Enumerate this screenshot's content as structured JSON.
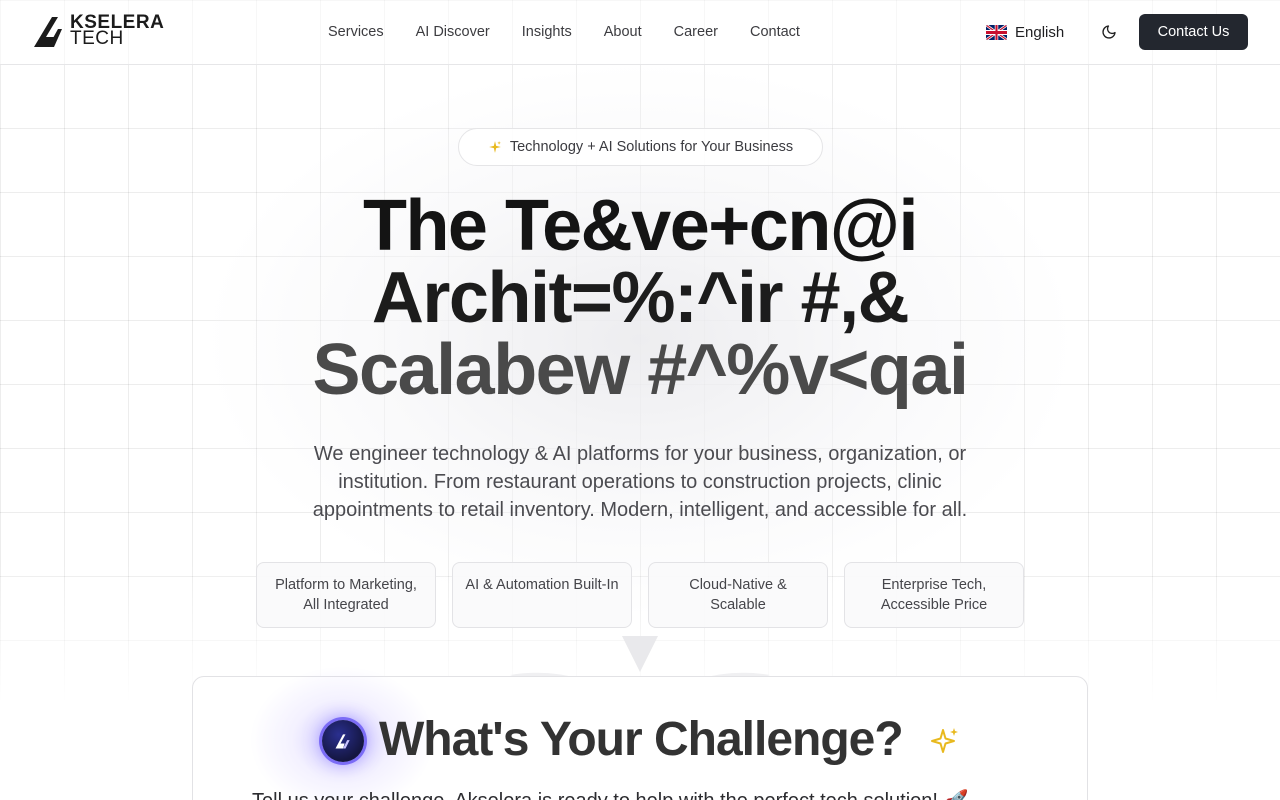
{
  "header": {
    "logo": {
      "line1": "KSELERA",
      "line2": "TECH"
    },
    "nav": [
      "Services",
      "AI Discover",
      "Insights",
      "About",
      "Career",
      "Contact"
    ],
    "language": {
      "label": "English",
      "icon": "uk-flag-icon"
    },
    "theme_icon": "moon-icon",
    "contact_label": "Contact Us"
  },
  "hero": {
    "badge": {
      "icon": "sparkle-icon",
      "text": "Technology + AI Solutions for Your Business"
    },
    "title_lines": [
      "The Te&ve+cn@i",
      "Archit=%:^ir #,&",
      "Scalabew #^%v<qai"
    ],
    "description": "We engineer technology & AI platforms for your business, organization, or institution. From restaurant operations to construction projects, clinic appointments to retail inventory. Modern, intelligent, and accessible for all.",
    "features": [
      {
        "line1": "Platform to Marketing,",
        "line2": "All Integrated"
      },
      {
        "line1": "AI & Automation Built-In",
        "line2": ""
      },
      {
        "line1": "Cloud-Native &",
        "line2": "Scalable"
      },
      {
        "line1": "Enterprise Tech,",
        "line2": "Accessible Price"
      }
    ]
  },
  "challenge": {
    "title": "What's Your Challenge?",
    "title_icon": "sparkles-icon",
    "subtitle": "Tell us your challenge. Akselera is ready to help with the perfect tech solution! 🚀"
  },
  "colors": {
    "primary_button": "#23272f",
    "accent_glow": "#7b6cf6",
    "sparkle": "#e8b91e"
  }
}
